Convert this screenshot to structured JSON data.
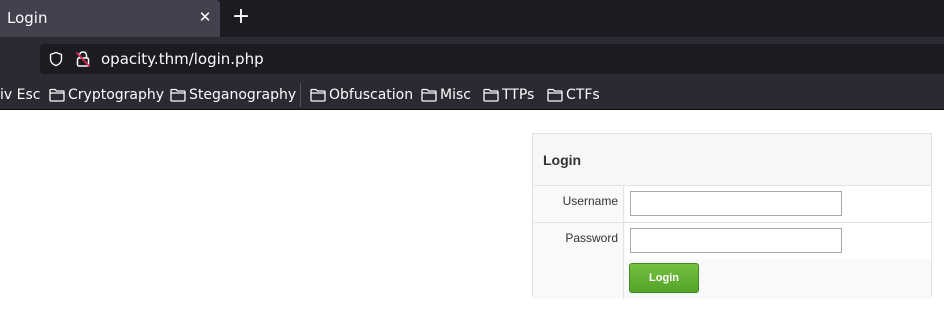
{
  "browser": {
    "tab": {
      "title": "Login",
      "close_glyph": "✕"
    },
    "new_tab_glyph": "+",
    "address": {
      "url": "opacity.thm/login.php",
      "security_icon": "shield-icon",
      "lock_icon": "insecure-lock-icon"
    },
    "bookmarks": [
      {
        "label": "iv Esc",
        "icon": ""
      },
      {
        "label": "Cryptography",
        "icon": "folder-icon"
      },
      {
        "label": "Steganography",
        "icon": "folder-icon"
      },
      {
        "label": "Obfuscation",
        "icon": "folder-icon"
      },
      {
        "label": "Misc",
        "icon": "folder-icon"
      },
      {
        "label": "TTPs",
        "icon": "folder-icon"
      },
      {
        "label": "CTFs",
        "icon": "folder-icon"
      }
    ]
  },
  "login_form": {
    "title": "Login",
    "username_label": "Username",
    "username_value": "",
    "password_label": "Password",
    "password_value": "",
    "submit_label": "Login",
    "accent_color": "#5cb030"
  }
}
